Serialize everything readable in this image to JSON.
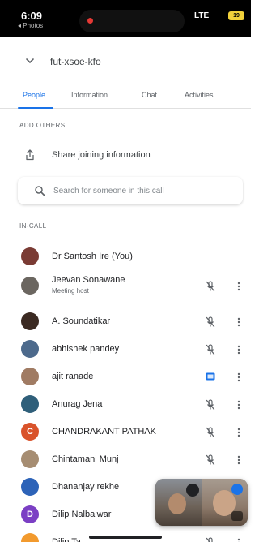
{
  "status_bar": {
    "time": "6:09",
    "back_label": "◂ Photos",
    "signal": "LTE",
    "battery": "19"
  },
  "header": {
    "meeting_code": "fut-xsoe-kfo"
  },
  "tabs": [
    {
      "label": "People",
      "active": true
    },
    {
      "label": "Information",
      "active": false
    },
    {
      "label": "Chat",
      "active": false
    },
    {
      "label": "Activities",
      "active": false
    }
  ],
  "add_others": {
    "section_label": "ADD OTHERS",
    "share_label": "Share joining information",
    "search_placeholder": "Search for someone in this call"
  },
  "in_call": {
    "section_label": "IN-CALL",
    "participants": [
      {
        "name": "Dr Santosh Ire (You)",
        "subtitle": "",
        "status_icon": "none",
        "avatar_color": "#7a3b34",
        "initial": ""
      },
      {
        "name": "Jeevan Sonawane",
        "subtitle": "Meeting host",
        "status_icon": "mic-off-icon",
        "avatar_color": "#6b6660",
        "initial": ""
      },
      {
        "name": "A. Soundatikar",
        "subtitle": "",
        "status_icon": "mic-off-icon",
        "avatar_color": "#3b2a22",
        "initial": ""
      },
      {
        "name": "abhishek pandey",
        "subtitle": "",
        "status_icon": "mic-off-icon",
        "avatar_color": "#4d6a8c",
        "initial": ""
      },
      {
        "name": "ajit ranade",
        "subtitle": "",
        "status_icon": "presenting-icon",
        "avatar_color": "#a07b63",
        "initial": ""
      },
      {
        "name": "Anurag Jena",
        "subtitle": "",
        "status_icon": "mic-off-icon",
        "avatar_color": "#2f5f7a",
        "initial": ""
      },
      {
        "name": "CHANDRAKANT PATHAK",
        "subtitle": "",
        "status_icon": "mic-off-icon",
        "avatar_color": "#d9532b",
        "initial": "C"
      },
      {
        "name": "Chintamani Munj",
        "subtitle": "",
        "status_icon": "mic-off-icon",
        "avatar_color": "#a68d72",
        "initial": ""
      },
      {
        "name": "Dhananjay rekhe",
        "subtitle": "",
        "status_icon": "none",
        "avatar_color": "#2d63b8",
        "initial": ""
      },
      {
        "name": "Dilip Nalbalwar",
        "subtitle": "",
        "status_icon": "none",
        "avatar_color": "#7b3fc4",
        "initial": "D"
      },
      {
        "name": "Dilip Ta",
        "subtitle": "",
        "status_icon": "mic-off-icon",
        "avatar_color": "#f29a2e",
        "initial": ""
      }
    ]
  },
  "colors": {
    "accent": "#1a73e8",
    "text_primary": "#202124",
    "text_secondary": "#5f6368"
  }
}
